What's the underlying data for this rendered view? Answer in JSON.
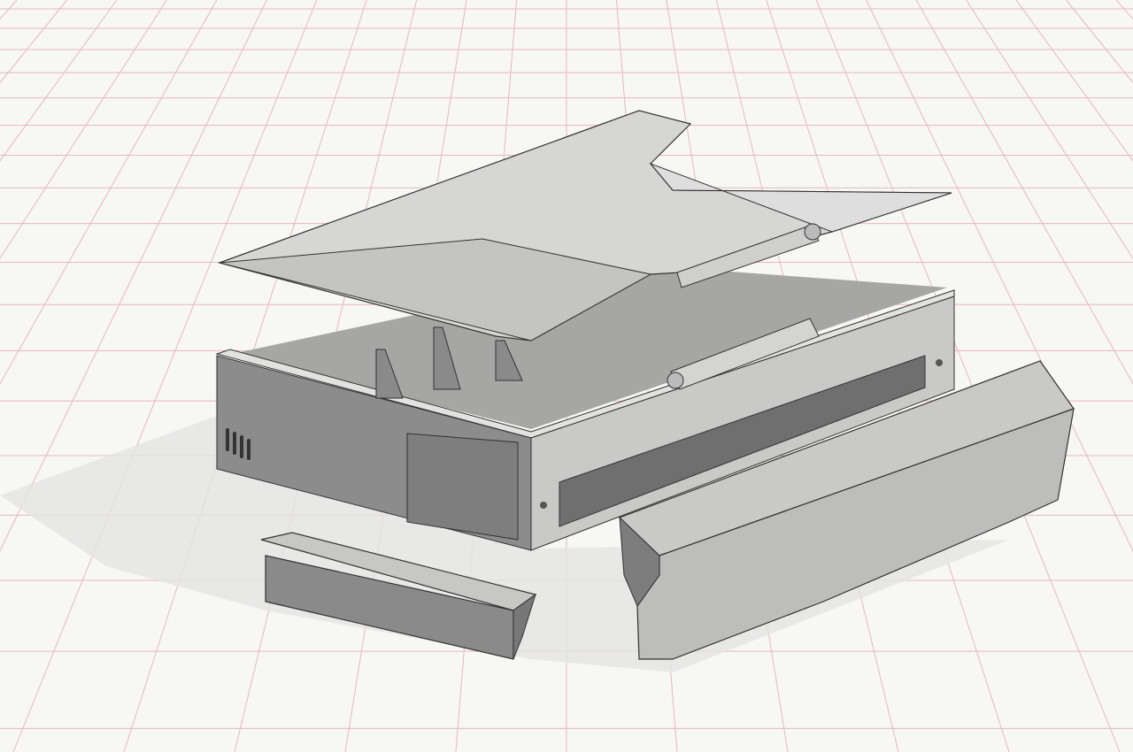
{
  "scene": {
    "background_color": "#f7f7f4",
    "grid_color": "#e8b7c0",
    "part_colors": {
      "lid": "#d6d6d4",
      "box_front": "#8c8c8c",
      "box_side": "#c9c9c7",
      "interior": "#a9a9a7",
      "bar": "#bdbdbb",
      "bar_dark": "#7d7d7d"
    }
  }
}
